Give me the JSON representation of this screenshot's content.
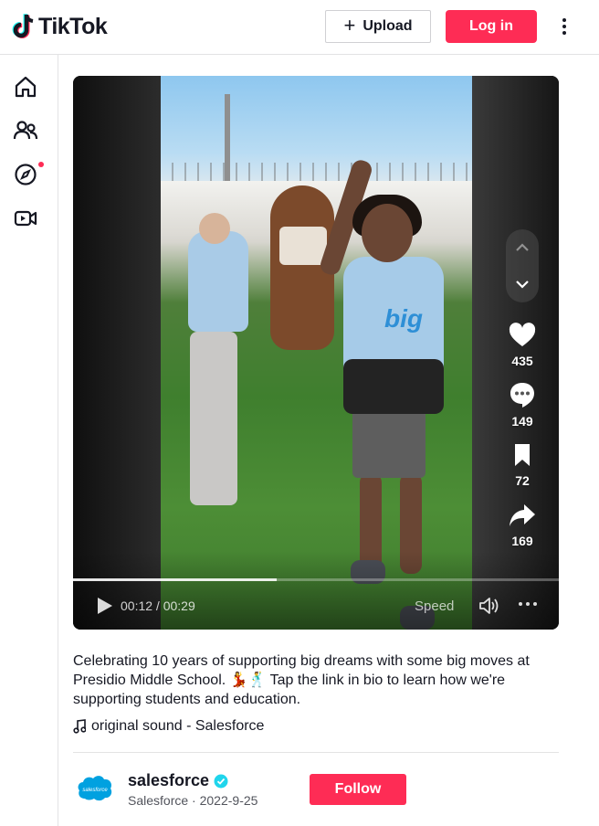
{
  "header": {
    "logo_text": "TikTok",
    "upload_label": "Upload",
    "login_label": "Log in"
  },
  "sidebar": {
    "items": [
      {
        "name": "home",
        "icon": "home-icon"
      },
      {
        "name": "following",
        "icon": "people-icon"
      },
      {
        "name": "explore",
        "icon": "compass-icon",
        "badge": true
      },
      {
        "name": "live",
        "icon": "live-video-icon"
      }
    ]
  },
  "video": {
    "likes": "435",
    "comments": "149",
    "saves": "72",
    "shares": "169",
    "time": "00:12 / 00:29",
    "speed_label": "Speed",
    "progress": 0.42
  },
  "post": {
    "caption": "Celebrating 10 years of supporting big dreams with some big moves at Presidio Middle School. 💃🕺 Tap the link in bio to learn how we're supporting students and education.",
    "music": "original sound - Salesforce",
    "author_handle": "salesforce",
    "author_name": "Salesforce",
    "date": "2022-9-25",
    "avatar_text": "salesforce",
    "follow_label": "Follow"
  },
  "colors": {
    "brand": "#fe2c55",
    "verified": "#20d5ec",
    "salesforce_blue": "#00a1e0"
  }
}
